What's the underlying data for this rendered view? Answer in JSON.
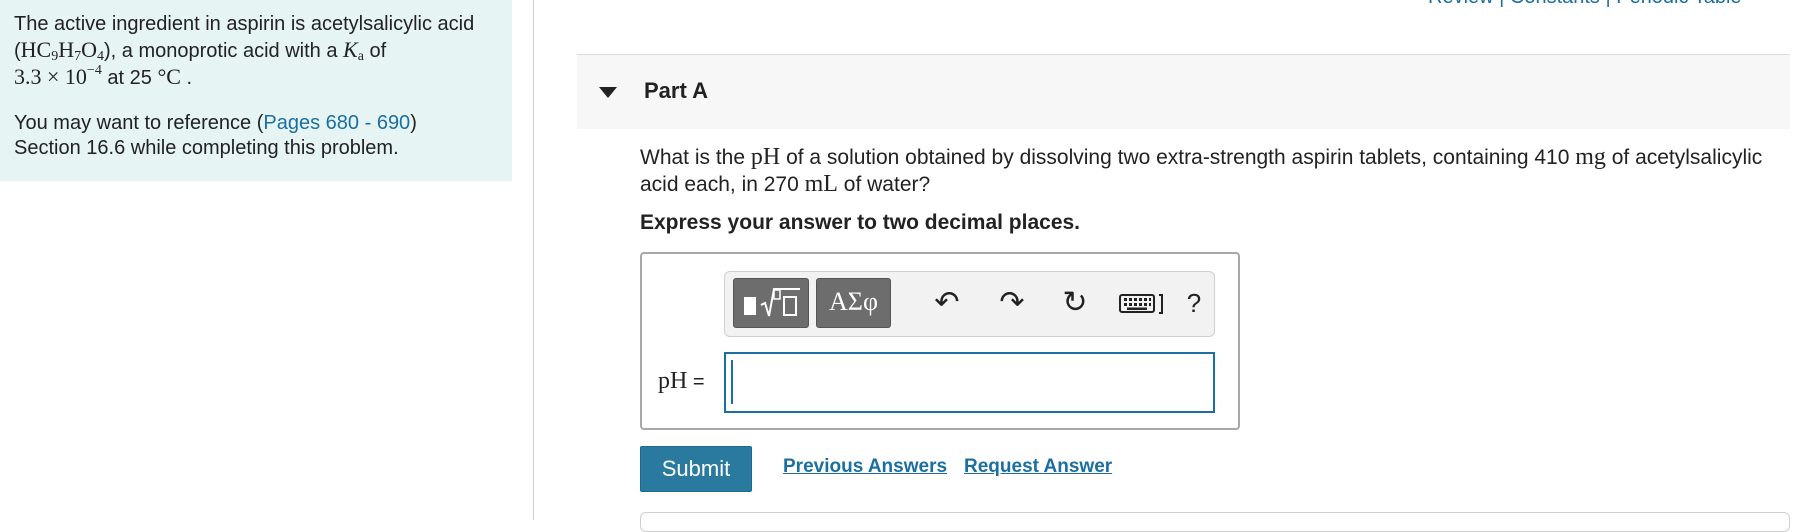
{
  "problem": {
    "intro": "The active ingredient in aspirin is acetylsalicylic acid (",
    "formula_parts": [
      "HC",
      "9",
      "H",
      "7",
      "O",
      "4"
    ],
    "intro_after_formula": "), a monoprotic acid with a ",
    "ka_symbol": "K",
    "ka_sub": "a",
    "of_text": " of",
    "ka_value_prefix": "3.3 × 10",
    "ka_exponent": "−4",
    "temperature_text": " at 25 ",
    "temperature_unit": "°C",
    "period": " .",
    "reference_prefix": "You may want to reference (",
    "reference_link": "Pages 680 - 690",
    "reference_suffix": ")",
    "reference_line2": "Section 16.6 while completing this problem."
  },
  "top_links": {
    "text": "Review | Constants | Periodic Table"
  },
  "part": {
    "title": "Part A"
  },
  "question": {
    "t1": "What is the ",
    "pH": "pH",
    "t2": " of a solution obtained by dissolving two extra-strength aspirin tablets, containing 410 ",
    "mg": "mg",
    "t3": " of acetylsalicylic acid each, in 270 ",
    "mL": "mL",
    "t4": " of water?"
  },
  "instruction": "Express your answer to two decimal places.",
  "toolbar": {
    "greek_label": "ΑΣφ",
    "undo_icon": "↶",
    "redo_icon": "↷",
    "reset_icon": "↻",
    "help_label": "?"
  },
  "answer": {
    "label": "pH",
    "equals": " =",
    "value": ""
  },
  "buttons": {
    "submit": "Submit",
    "previous_answers": "Previous Answers",
    "request_answer": "Request Answer"
  },
  "colors": {
    "link": "#1a6fa0",
    "submit_bg": "#2a7aa0",
    "panel_bg": "#e6f4f4",
    "toolbar_btn": "#6d6d6d"
  }
}
